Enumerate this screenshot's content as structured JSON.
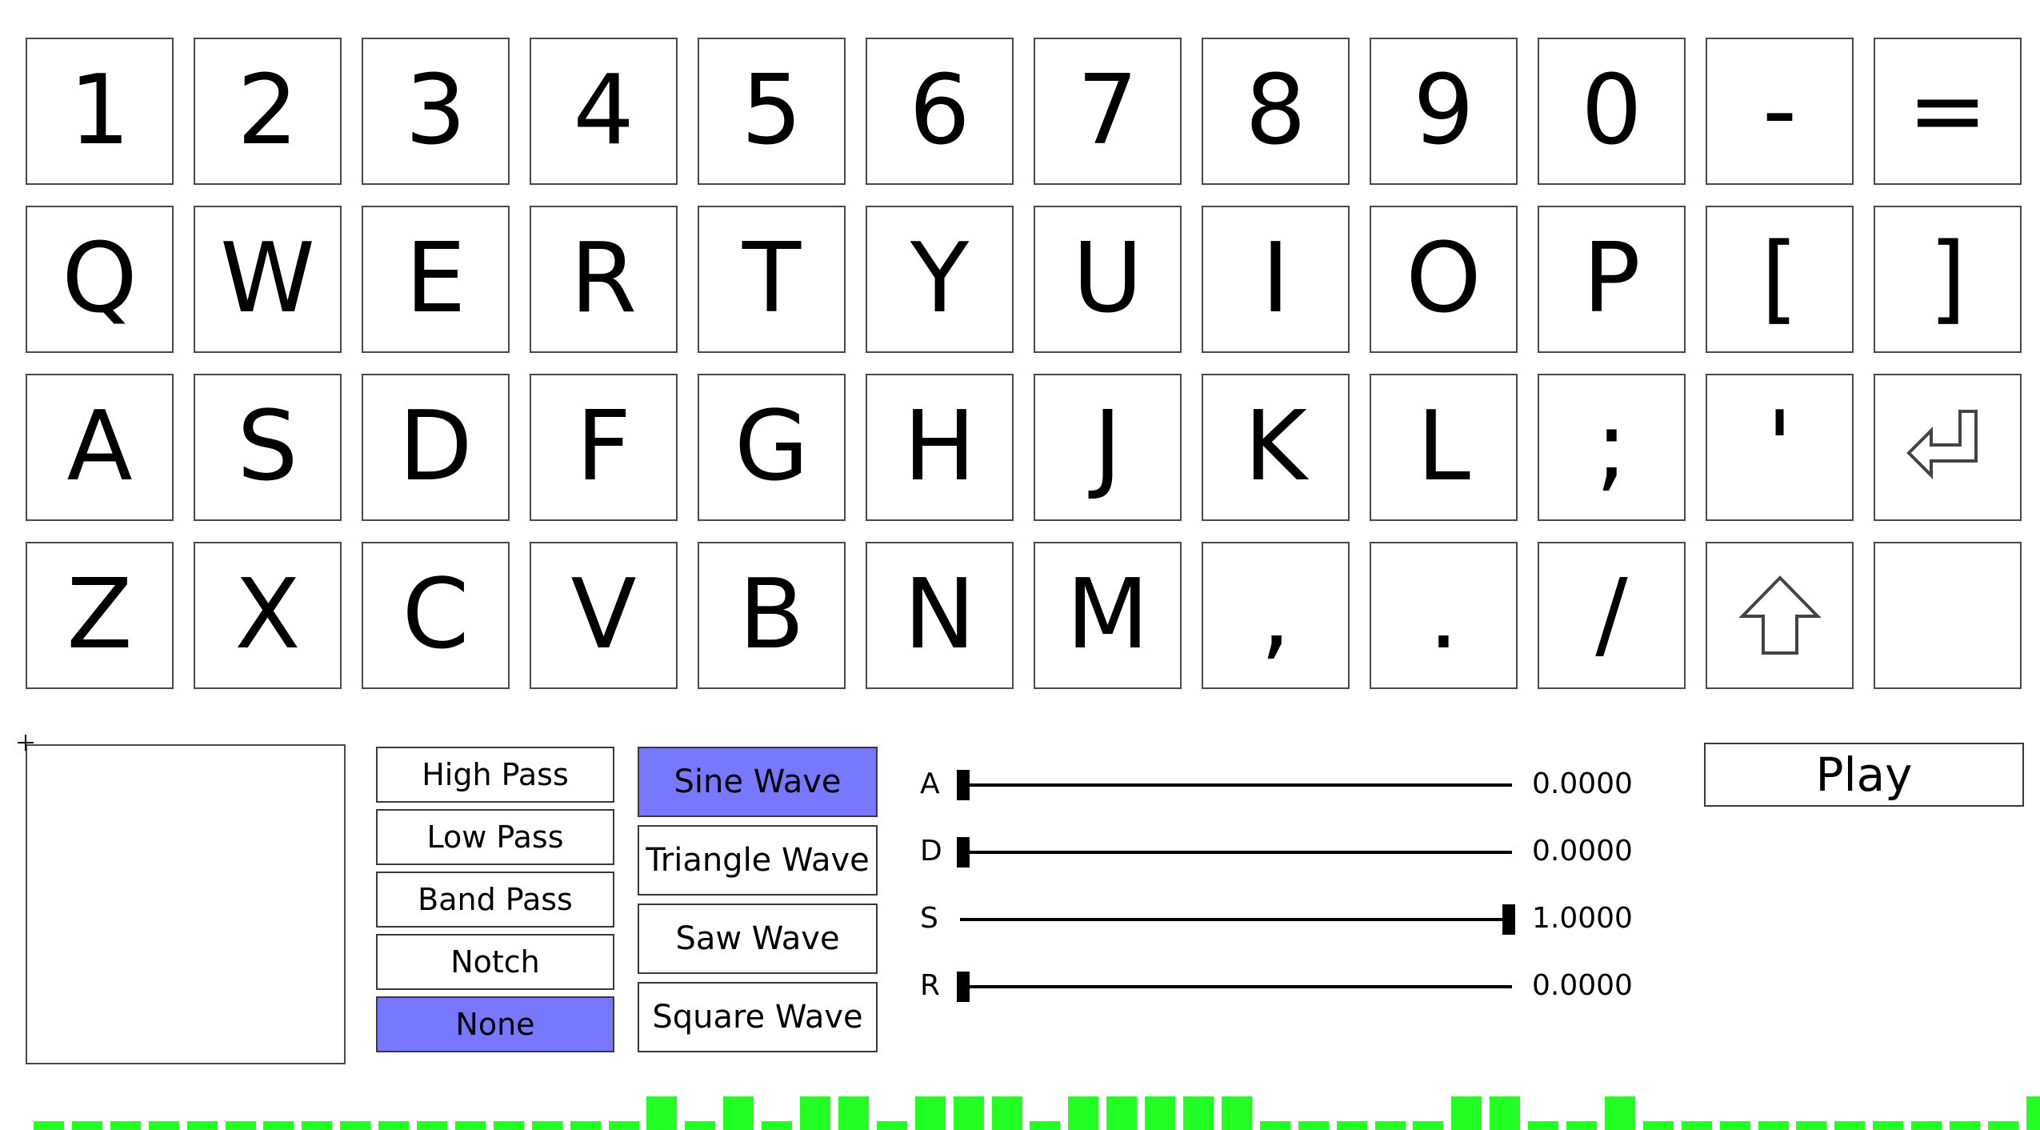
{
  "keyboard": {
    "rows": [
      [
        {
          "label": "1",
          "name": "key-1"
        },
        {
          "label": "2",
          "name": "key-2"
        },
        {
          "label": "3",
          "name": "key-3"
        },
        {
          "label": "4",
          "name": "key-4"
        },
        {
          "label": "5",
          "name": "key-5"
        },
        {
          "label": "6",
          "name": "key-6"
        },
        {
          "label": "7",
          "name": "key-7"
        },
        {
          "label": "8",
          "name": "key-8"
        },
        {
          "label": "9",
          "name": "key-9"
        },
        {
          "label": "0",
          "name": "key-0"
        },
        {
          "label": "-",
          "name": "key-minus"
        },
        {
          "label": "=",
          "name": "key-equals"
        }
      ],
      [
        {
          "label": "Q",
          "name": "key-q"
        },
        {
          "label": "W",
          "name": "key-w"
        },
        {
          "label": "E",
          "name": "key-e"
        },
        {
          "label": "R",
          "name": "key-r"
        },
        {
          "label": "T",
          "name": "key-t"
        },
        {
          "label": "Y",
          "name": "key-y"
        },
        {
          "label": "U",
          "name": "key-u"
        },
        {
          "label": "I",
          "name": "key-i"
        },
        {
          "label": "O",
          "name": "key-o"
        },
        {
          "label": "P",
          "name": "key-p"
        },
        {
          "label": "[",
          "name": "key-left-bracket"
        },
        {
          "label": "]",
          "name": "key-right-bracket"
        }
      ],
      [
        {
          "label": "A",
          "name": "key-a"
        },
        {
          "label": "S",
          "name": "key-s"
        },
        {
          "label": "D",
          "name": "key-d"
        },
        {
          "label": "F",
          "name": "key-f"
        },
        {
          "label": "G",
          "name": "key-g"
        },
        {
          "label": "H",
          "name": "key-h"
        },
        {
          "label": "J",
          "name": "key-j"
        },
        {
          "label": "K",
          "name": "key-k"
        },
        {
          "label": "L",
          "name": "key-l"
        },
        {
          "label": ";",
          "name": "key-semicolon"
        },
        {
          "label": "'",
          "name": "key-apostrophe"
        },
        {
          "icon": "enter-arrow-icon",
          "name": "key-enter"
        }
      ],
      [
        {
          "label": "Z",
          "name": "key-z"
        },
        {
          "label": "X",
          "name": "key-x"
        },
        {
          "label": "C",
          "name": "key-c"
        },
        {
          "label": "V",
          "name": "key-v"
        },
        {
          "label": "B",
          "name": "key-b"
        },
        {
          "label": "N",
          "name": "key-n"
        },
        {
          "label": "M",
          "name": "key-m"
        },
        {
          "label": ",",
          "name": "key-comma"
        },
        {
          "label": ".",
          "name": "key-period"
        },
        {
          "label": "/",
          "name": "key-slash"
        },
        {
          "icon": "shift-arrow-icon",
          "name": "key-shift"
        },
        {
          "label": "",
          "name": "key-blank"
        }
      ]
    ]
  },
  "filters": {
    "items": [
      {
        "label": "High Pass",
        "active": false,
        "name": "filter-high-pass-button"
      },
      {
        "label": "Low Pass",
        "active": false,
        "name": "filter-low-pass-button"
      },
      {
        "label": "Band Pass",
        "active": false,
        "name": "filter-band-pass-button"
      },
      {
        "label": "Notch",
        "active": false,
        "name": "filter-notch-button"
      },
      {
        "label": "None",
        "active": true,
        "name": "filter-none-button"
      }
    ]
  },
  "waves": {
    "items": [
      {
        "label": "Sine Wave",
        "active": true,
        "name": "wave-sine-button"
      },
      {
        "label": "Triangle Wave",
        "active": false,
        "name": "wave-triangle-button"
      },
      {
        "label": "Saw Wave",
        "active": false,
        "name": "wave-saw-button"
      },
      {
        "label": "Square Wave",
        "active": false,
        "name": "wave-square-button"
      }
    ]
  },
  "adsr": {
    "sliders": [
      {
        "label": "A",
        "value": "0.0000",
        "fraction": 0.0,
        "name": "attack"
      },
      {
        "label": "D",
        "value": "0.0000",
        "fraction": 0.0,
        "name": "decay"
      },
      {
        "label": "S",
        "value": "1.0000",
        "fraction": 1.0,
        "name": "sustain"
      },
      {
        "label": "R",
        "value": "0.0000",
        "fraction": 0.0,
        "name": "release"
      }
    ]
  },
  "play": {
    "label": "Play"
  },
  "colors": {
    "active_button": "#7777ff",
    "meter_green": "#22ff22"
  },
  "level_meter": {
    "levels": [
      0.25,
      0.25,
      0.25,
      0.25,
      0.25,
      0.25,
      0.25,
      0.25,
      0.25,
      0.25,
      0.25,
      0.25,
      0.25,
      0.25,
      0.25,
      0.25,
      1,
      0.25,
      1,
      0.25,
      1,
      1,
      0.25,
      1,
      1,
      1,
      0.25,
      1,
      1,
      1,
      1,
      1,
      0.25,
      0.25,
      0.25,
      0.25,
      0.25,
      1,
      1,
      0.25,
      0.25,
      1,
      0.25,
      0.25,
      0.25,
      0.25,
      0.25,
      0.25,
      0.25,
      0.25,
      0.25,
      0.25,
      1
    ]
  }
}
